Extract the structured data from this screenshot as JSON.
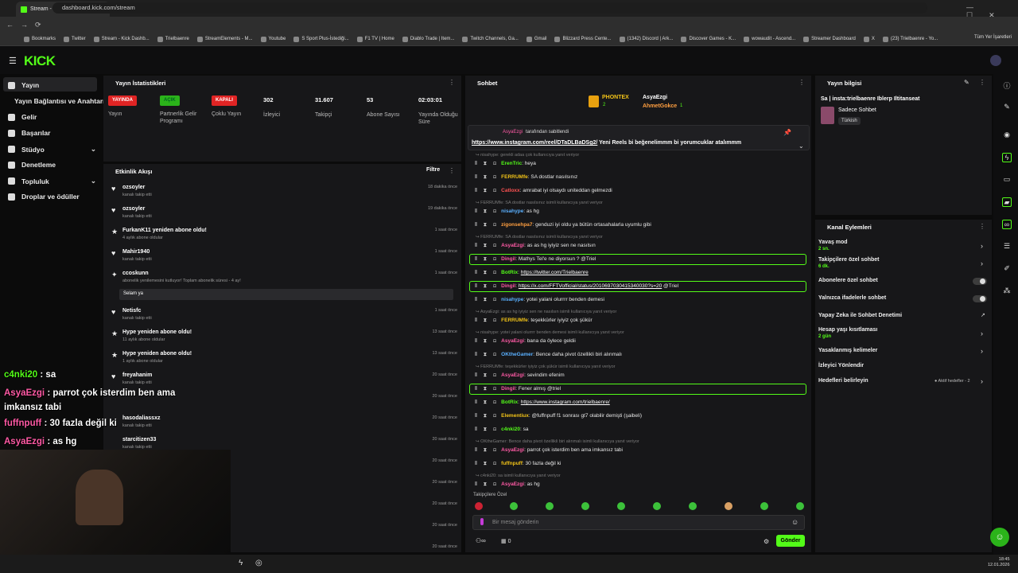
{
  "browser": {
    "tab_title": "Stream - Kick Dashboard",
    "url": "dashboard.kick.com/stream",
    "bookmarks": [
      "Bookmarks",
      "Twitter",
      "Stream - Kick Dashb...",
      "Trielbaenre",
      "StreamElements - M...",
      "Youtube",
      "S Sport Plus-İstediği...",
      "F1 TV | Home",
      "Diablo Trade | Item...",
      "Twitch Channels, Ga...",
      "Gmail",
      "Blizzard Press Cente...",
      "(1342) Discord | Ark...",
      "Discover Games - K...",
      "wowaudit - Ascend...",
      "Streamer Dashboard",
      "X",
      "(23) Trielbaenre - Yo..."
    ],
    "all_bookmarks": "Tüm Yer İşaretleri"
  },
  "sidebar": {
    "items": [
      "Yayın",
      "Yayın Bağlantısı ve Anahtarı",
      "Gelir",
      "Başarılar",
      "Stüdyo",
      "Denetleme",
      "Topluluk",
      "Droplar ve ödüller"
    ]
  },
  "stats": {
    "title": "Yayın İstatistikleri",
    "items": [
      {
        "value": "YAYINDA",
        "label": "Yayın",
        "color": "#e02424"
      },
      {
        "value": "AÇIK",
        "label": "Partnerlik Gelir Programı",
        "color": "#2bb31a"
      },
      {
        "value": "KAPALI",
        "label": "Çoklu Yayın",
        "color": "#e02424"
      },
      {
        "value": "302",
        "label": "İzleyici"
      },
      {
        "value": "31.607",
        "label": "Takipçi"
      },
      {
        "value": "53",
        "label": "Abone Sayısı"
      },
      {
        "value": "02:03:01",
        "label": "Yayında Olduğu Süre"
      }
    ]
  },
  "activity": {
    "title": "Etkinlik Akışı",
    "filter": "Filtre",
    "items": [
      {
        "name": "ozsoyler",
        "sub": "kanalı takip etti",
        "time": "18 dakika önce",
        "icon": "♥"
      },
      {
        "name": "ozsoyler",
        "sub": "kanalı takip etti",
        "time": "19 dakika önce",
        "icon": "♥"
      },
      {
        "name": "FurkanK11 yeniden abone oldu!",
        "sub": "4 aylık abone oldular",
        "time": "1 saat önce",
        "icon": "★"
      },
      {
        "name": "Mahir1940",
        "sub": "kanalı takip etti",
        "time": "1 saat önce",
        "icon": "♥"
      },
      {
        "name": "ccoskunn",
        "sub": "abonelik yenilemesini kutluyor! Toplam abonelik süresi - 4 ay!",
        "time": "1 saat önce",
        "icon": "✦",
        "note": "Selam ya"
      },
      {
        "name": "Netisfc",
        "sub": "kanalı takip etti",
        "time": "1 saat önce",
        "icon": "♥"
      },
      {
        "name": "Hype yeniden abone oldu!",
        "sub": "11 aylık abone oldular",
        "time": "13 saat önce",
        "icon": "★"
      },
      {
        "name": "Hype yeniden abone oldu!",
        "sub": "1 aylık abone oldular",
        "time": "13 saat önce",
        "icon": "★"
      },
      {
        "name": "freyahanim",
        "sub": "kanalı takip etti",
        "time": "20 saat önce",
        "icon": "♥"
      },
      {
        "name": "",
        "sub": "",
        "time": "20 saat önce",
        "icon": ""
      },
      {
        "name": "hasodaliassxz",
        "sub": "kanalı takip etti",
        "time": "20 saat önce",
        "icon": ""
      },
      {
        "name": "starcitizen33",
        "sub": "kanalı takip etti",
        "time": "20 saat önce",
        "icon": ""
      },
      {
        "name": "",
        "sub": "",
        "time": "20 saat önce",
        "icon": ""
      },
      {
        "name": "",
        "sub": "",
        "time": "20 saat önce",
        "icon": ""
      },
      {
        "name": "",
        "sub": "",
        "time": "20 saat önce",
        "icon": ""
      },
      {
        "name": "",
        "sub": "",
        "time": "20 saat önce",
        "icon": ""
      },
      {
        "name": "",
        "sub": "",
        "time": "20 saat önce",
        "icon": ""
      }
    ]
  },
  "overlay": [
    {
      "user": "c4nki20",
      "text": " : sa",
      "color": "#53fc18"
    },
    {
      "user": "AsyaEzgi",
      "text": " : parrot çok isterdim ben ama",
      "color": "#ff5aa5"
    },
    {
      "user": "",
      "text": "imkansız tabi",
      "color": "#fff"
    },
    {
      "user": "fuffnpuff",
      "text": " : 30 fazla değil ki",
      "color": "#ff5aa5"
    },
    {
      "user": "AsyaEzgi",
      "text": " : as hg",
      "color": "#ff5aa5"
    }
  ],
  "chat": {
    "title": "Sohbet",
    "top1": "PHONTEX",
    "top1n": "2",
    "top2": "AsyaEzgi",
    "top3": "AhmetGokce",
    "top3n": "1",
    "pinned_by": "AsyaEzgi",
    "pinned_label": "tarafından sabitlendi",
    "pinned_link": "https://www.instagram.com/reel/DTaDLBaDSg2/",
    "pinned_text": " Yeni Reels bi beğenelimmm bi yorumcuklar atalımmm",
    "messages": [
      {
        "type": "reply",
        "text": "nisahype: gerekli adaa çok kullanıcıya yanıt veriyor"
      },
      {
        "user": "ErenTric",
        "color": "#53fc18",
        "text": ": heya"
      },
      {
        "user": "FERRUMfe",
        "color": "#f2c318",
        "text": ": SA dostlar nasılsınız"
      },
      {
        "user": "Catloxx",
        "color": "#ff5252",
        "text": ": amrabat iyi olsaydı uniteddan gelmezdi"
      },
      {
        "type": "reply",
        "text": "FERRUMfe: SA dostlar nasılsınız isimli kullanıcıya yanıt veriyor"
      },
      {
        "user": "nisahype",
        "color": "#5ab0ff",
        "text": ": as hg"
      },
      {
        "user": "zigonsehpa7",
        "color": "#ff9f40",
        "text": ": genduzi iyi oldu ya bütün ortasahalarla uyumlu gibi"
      },
      {
        "type": "reply",
        "text": "FERRUMfe: SA dostlar nasılsınız isimli kullanıcıya yanıt veriyor"
      },
      {
        "user": "AsyaEzgi",
        "color": "#ff5aa5",
        "text": ": as as hg iyiyiz sen ne nasılsın"
      },
      {
        "user": "Dingil",
        "color": "#ff5aa5",
        "text": ": Mathys Tel'e ne diyorsun ? @Triel",
        "hl": true
      },
      {
        "user": "BotRix",
        "color": "#53fc18",
        "text": ": ",
        "link": "https://twitter.com/Trielbaenre"
      },
      {
        "user": "Dingil",
        "color": "#ff5aa5",
        "text": ": ",
        "link": "https://x.com/FFTVofficial/status/2010697030415340030?s=20",
        "after": " @Triel",
        "hl": true
      },
      {
        "user": "nisahype",
        "color": "#5ab0ff",
        "text": ": yotei yalani olurrrr benden demesi"
      },
      {
        "type": "reply",
        "text": "AsyaEzgi: as as hg iyiyiz sen ne nasılsın isimli kullanıcıya yanıt veriyor"
      },
      {
        "user": "FERRUMfe",
        "color": "#f2c318",
        "text": ": teşekkürler iyiyiz çok şükür"
      },
      {
        "type": "reply",
        "text": "nisahype: yotei yalani olurrrr benden demesi isimli kullanıcıya yanıt veriyor"
      },
      {
        "user": "AsyaEzgi",
        "color": "#ff5aa5",
        "text": ": bana da öylece geldii"
      },
      {
        "user": "OKtheGamer",
        "color": "#5ab0ff",
        "text": ": Bence daha pivot özellikli biri alınmalı"
      },
      {
        "type": "reply",
        "text": "FERRUMfe: teşekkürler iyiyiz çok şükür isimli kullanıcıya yanıt veriyor"
      },
      {
        "user": "AsyaEzgi",
        "color": "#ff5aa5",
        "text": ": sevindim efenim"
      },
      {
        "user": "Dingil",
        "color": "#ff5aa5",
        "text": ": Fener almış @triel",
        "hl": true
      },
      {
        "user": "BotRix",
        "color": "#53fc18",
        "text": ": ",
        "link": "https://www.instagram.com/trielbaenre/"
      },
      {
        "user": "Elementiux",
        "color": "#f2c318",
        "text": ": @fuffnpuff f1 sonrası gt7 olabilir demişti (şaibeli)"
      },
      {
        "user": "c4nki20",
        "color": "#53fc18",
        "text": ": sa"
      },
      {
        "type": "reply",
        "text": "OKtheGamer: Bence daha pivot özellikli biri alınmalı isimli kullanıcıya yanıt veriyor"
      },
      {
        "user": "AsyaEzgi",
        "color": "#ff5aa5",
        "text": ": parrot çok isterdim ben ama imkansız tabi"
      },
      {
        "user": "fuffnpuff",
        "color": "#f2c318",
        "text": ": 30 fazla değil ki"
      },
      {
        "type": "reply",
        "text": "c4nki20: sa isimli kullanıcıya yanıt veriyor"
      },
      {
        "user": "AsyaEzgi",
        "color": "#ff5aa5",
        "text": ": as hg"
      }
    ],
    "followers_only": "Takipçilere Özel",
    "placeholder": "Bir mesaj gönderin",
    "send": "Gönder",
    "count": "0"
  },
  "info": {
    "title": "Yayın bilgisi",
    "stream_title": "Sa | insta:trielbaenre Iblerp Iltitanseat",
    "category": "Sadece Sohbet",
    "tag": "Türkish"
  },
  "actions": {
    "title": "Kanal Eylemleri",
    "items": [
      {
        "label": "Yavaş mod",
        "sub": "2 sn.",
        "ctrl": "chevron"
      },
      {
        "label": "Takipçilere özel sohbet",
        "sub": "6 dk.",
        "ctrl": "chevron"
      },
      {
        "label": "Abonelere özel sohbet",
        "sub": "",
        "ctrl": "toggle"
      },
      {
        "label": "Yalnızca ifadelerle sohbet",
        "sub": "",
        "ctrl": "toggle"
      },
      {
        "label": "Yapay Zeka ile Sohbet Denetimi",
        "sub": "",
        "ctrl": "ext"
      },
      {
        "label": "Hesap yaşı kısıtlaması",
        "sub": "2 gün",
        "ctrl": "chevron"
      },
      {
        "label": "Yasaklanmış kelimeler",
        "sub": "",
        "ctrl": "chevron"
      },
      {
        "label": "İzleyici Yönlendir",
        "sub": "",
        "ctrl": ""
      },
      {
        "label": "Hedefleri belirleyin",
        "sub": "",
        "ctrl": "chevron",
        "extra": "● Aktif hedefler - 2"
      }
    ]
  },
  "taskbar": {
    "time": "18:45",
    "date": "12.01.2026"
  }
}
